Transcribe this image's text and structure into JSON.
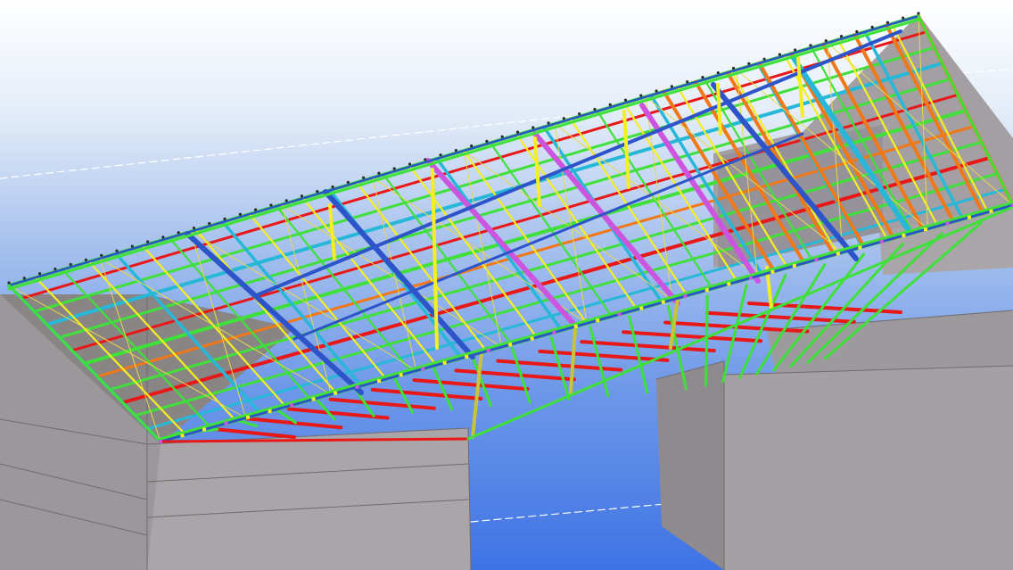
{
  "viewport": {
    "view_type": "3d-model-view",
    "render_mode": "shaded",
    "background_gradient": [
      "#ffffff",
      "#a9c3ee",
      "#3f73e6"
    ]
  },
  "model": {
    "subject": "steel-roof-truss-structure",
    "colors": {
      "concrete_top": "#8a8585",
      "concrete_side": "#aaa5a8",
      "concrete_edge": "#6f6b6e",
      "chord_green": "#3fe03a",
      "member_blue": "#2d54c8",
      "member_cyan": "#27b7d8",
      "member_red": "#e81818",
      "member_orange": "#f07818",
      "member_yellow": "#f4ee22",
      "member_magenta": "#cc55e0",
      "member_olive": "#c8c43a",
      "bracing_line": "#e8d84a",
      "grid_line": "#ffffff"
    }
  }
}
